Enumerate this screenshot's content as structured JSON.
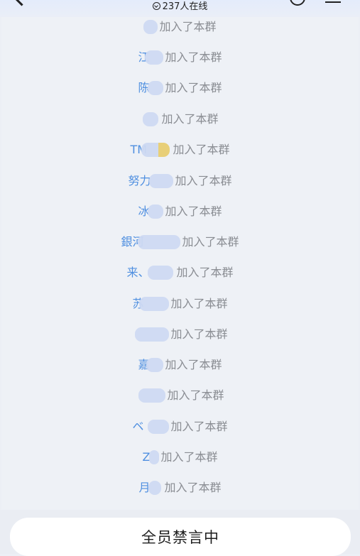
{
  "header": {
    "member_count": "237人在线"
  },
  "events": [
    {
      "name": "",
      "action": "加入了本群"
    },
    {
      "name": "江",
      "action": "加入了本群"
    },
    {
      "name": "陈",
      "action": "加入了本群"
    },
    {
      "name": "",
      "action": "加入了本群"
    },
    {
      "name": "TM",
      "action": "加入了本群"
    },
    {
      "name": "努力",
      "action": "加入了本群"
    },
    {
      "name": "冰",
      "action": "加入了本群"
    },
    {
      "name": "銀河",
      "action": "加入了本群"
    },
    {
      "name": "来、",
      "action": "加入了本群"
    },
    {
      "name": "苏",
      "action": "加入了本群"
    },
    {
      "name": "",
      "action": "加入了本群"
    },
    {
      "name": "嘉",
      "action": "加入了本群"
    },
    {
      "name": "",
      "action": "加入了本群"
    },
    {
      "name": "ベ",
      "action": "加入了本群"
    },
    {
      "name": "Z",
      "action": "加入了本群"
    },
    {
      "name": "月",
      "action": "加入了本群"
    }
  ],
  "footer": {
    "mute_text": "全员禁言中"
  }
}
